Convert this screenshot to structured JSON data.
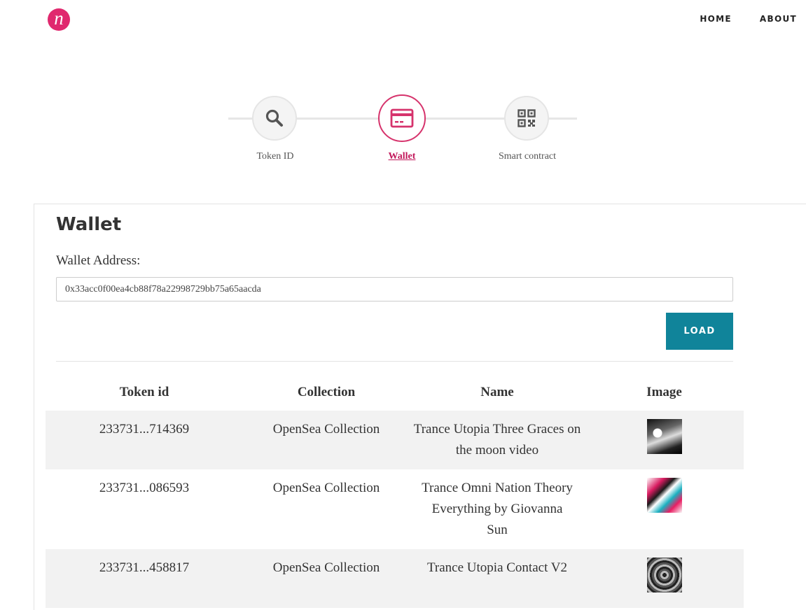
{
  "header": {
    "logo_letter": "n",
    "nav": [
      {
        "label": "HOME"
      },
      {
        "label": "ABOUT"
      }
    ]
  },
  "stepper": {
    "steps": [
      {
        "label": "Token ID",
        "icon": "search-icon",
        "active": false
      },
      {
        "label": "Wallet",
        "icon": "wallet-icon",
        "active": true
      },
      {
        "label": "Smart contract",
        "icon": "qr-code-icon",
        "active": false
      }
    ]
  },
  "colors": {
    "brand_pink": "#e0286e",
    "accent_teal": "#10849a",
    "row_stripe": "#f2f2f2"
  },
  "wallet": {
    "title": "Wallet",
    "address_label": "Wallet Address:",
    "address_value": "0x33acc0f00ea4cb88f78a22998729bb75a65aacda",
    "load_label": "LOAD"
  },
  "table": {
    "headers": [
      "Token id",
      "Collection",
      "Name",
      "Image"
    ],
    "rows": [
      {
        "token_id": "233731...714369",
        "collection": "OpenSea Collection",
        "name": "Trance Utopia Three Graces on the moon video",
        "image": "nft-thumbnail"
      },
      {
        "token_id": "233731...086593",
        "collection": "OpenSea Collection",
        "name": "Trance Omni Nation Theory Everything by Giovanna Sun",
        "image": "nft-thumbnail"
      },
      {
        "token_id": "233731...458817",
        "collection": "OpenSea Collection",
        "name": "Trance Utopia Contact V2",
        "image": "nft-thumbnail"
      }
    ]
  }
}
